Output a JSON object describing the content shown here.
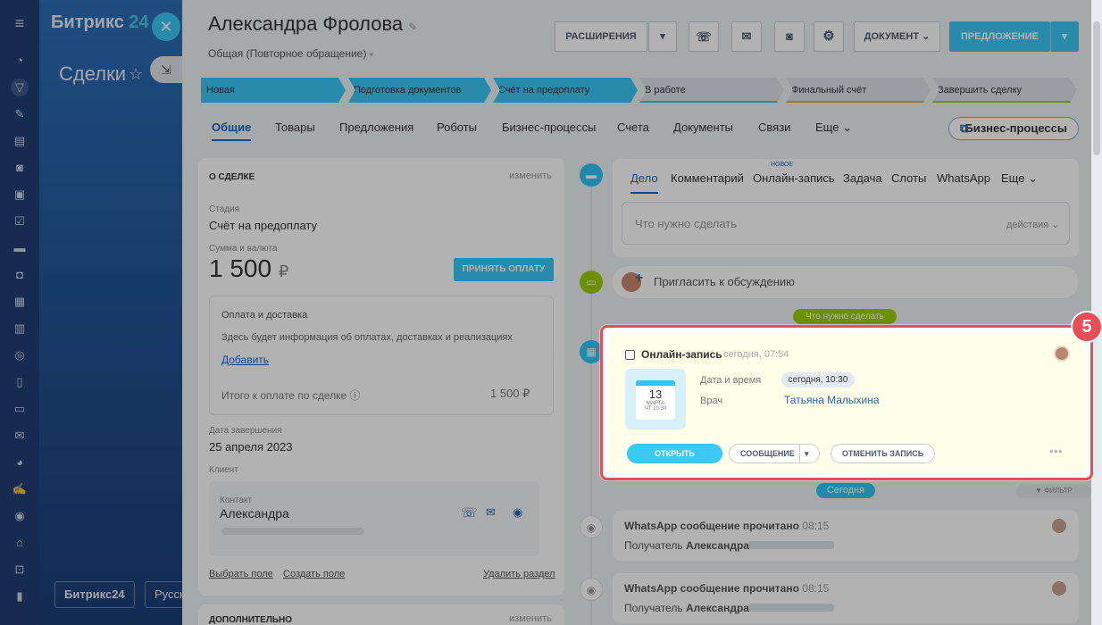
{
  "sidebar": {
    "logo_main": "Битрикс",
    "logo_num": "24",
    "deals_title": "Сделки",
    "bottom_logo": "Битрикс24",
    "lang": "Русский"
  },
  "header": {
    "title": "Александра Фролова",
    "subtitle": "Общая (Повторное обращение)",
    "buttons": {
      "extensions": "РАСШИРЕНИЯ",
      "document": "ДОКУМЕНТ",
      "proposal": "ПРЕДЛОЖЕНИЕ"
    }
  },
  "stages": [
    "Новая",
    "Подготовка документов",
    "Счёт на предоплату",
    "В работе",
    "Финальный счёт",
    "Завершить сделку"
  ],
  "colors": {
    "stage_active": "#3bc8f5",
    "stage_inactive": "#dde3e9",
    "accent_blue": "#2066b0",
    "highlight_red": "#e94e57",
    "green": "#9dcf00"
  },
  "tabs": [
    "Общие",
    "Товары",
    "Предложения",
    "Роботы",
    "Бизнес-процессы",
    "Счета",
    "Документы",
    "Связи",
    "Еще"
  ],
  "bp_button": "Бизнес-процессы",
  "about": {
    "header": "О СДЕЛКЕ",
    "edit": "изменить",
    "stage_label": "Стадия",
    "stage_value": "Счёт на предоплату",
    "sum_label": "Сумма и валюта",
    "sum_value": "1 500",
    "currency": "₽",
    "accept_payment": "ПРИНЯТЬ ОПЛАТУ",
    "payment_title": "Оплата и доставка",
    "payment_info": "Здесь будет информация об оплатах, доставках и реализациях",
    "add": "Добавить",
    "total_label": "Итого к оплате по сделке",
    "total_value": "1 500 ₽",
    "close_date_label": "Дата завершения",
    "close_date": "25 апреля 2023",
    "client_label": "Клиент",
    "contact_label": "Контакт",
    "contact_name": "Александра",
    "select_field": "Выбрать поле",
    "create_field": "Создать поле",
    "delete_section": "Удалить раздел",
    "additional": "ДОПОЛНИТЕЛЬНО"
  },
  "activity": {
    "tabs": [
      "Дело",
      "Комментарий",
      "Онлайн-запись",
      "Задача",
      "Слоты",
      "WhatsApp",
      "Еще"
    ],
    "new_badge": "НОВОЕ",
    "placeholder": "Что нужно сделать",
    "actions": "действия",
    "invite": "Пригласить к обсуждению",
    "todo_pill": "Что нужно сделать"
  },
  "booking": {
    "title": "Онлайн-запись",
    "time": "сегодня, 07:54",
    "cal_day": "13",
    "cal_month": "МАРТА",
    "cal_time": "ЧТ 10:30",
    "datetime_label": "Дата и время",
    "datetime_value": "сегодня, 10:30",
    "doctor_label": "Врач",
    "doctor_value": "Татьяна Малыхина",
    "open": "ОТКРЫТЬ",
    "message": "СООБЩЕНИЕ",
    "cancel": "ОТМЕНИТЬ ЗАПИСЬ",
    "step": "5"
  },
  "timeline": {
    "today": "Сегодня",
    "filter": "ФИЛЬТР",
    "items": [
      {
        "title": "WhatsApp сообщение прочитано",
        "time": "08:15",
        "recipient_label": "Получатель",
        "recipient": "Александра"
      },
      {
        "title": "WhatsApp сообщение прочитано",
        "time": "08:15",
        "recipient_label": "Получатель",
        "recipient": "Александра"
      }
    ]
  }
}
